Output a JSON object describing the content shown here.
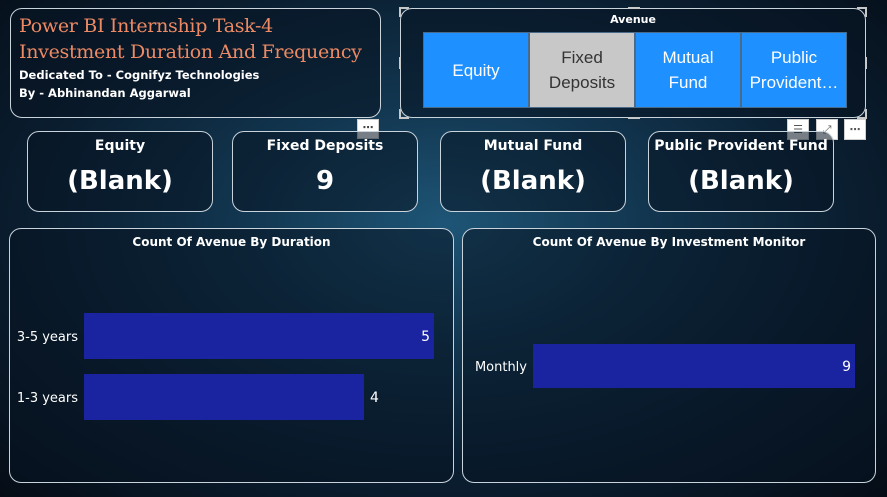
{
  "header": {
    "title_line1": "Power BI Internship Task-4",
    "title_line2": "Investment Duration And Frequency",
    "dedication": "Dedicated To - Cognifyz Technologies",
    "author": "By - Abhinandan Aggarwal",
    "more_icon": "⋯"
  },
  "slicer": {
    "title": "Avenue",
    "options": [
      {
        "label": "Equity",
        "selected": false
      },
      {
        "label": "Fixed Deposits",
        "selected": true
      },
      {
        "label": "Mutual Fund",
        "selected": false
      },
      {
        "label": "Public Provident…",
        "selected": false
      }
    ],
    "toolbar": {
      "filter_icon": "☰",
      "focus_icon": "⤢",
      "more_icon": "⋯"
    }
  },
  "cards": [
    {
      "label": "Equity",
      "value": "(Blank)"
    },
    {
      "label": "Fixed Deposits",
      "value": "9"
    },
    {
      "label": "Mutual Fund",
      "value": "(Blank)"
    },
    {
      "label": "Public Provident Fund",
      "value": "(Blank)"
    }
  ],
  "colors": {
    "bar": "#1a24a0",
    "slicer_active": "#1e90ff",
    "slicer_selected": "#c8c8c8",
    "title": "#ee8a63"
  },
  "chart_data": [
    {
      "type": "bar",
      "orientation": "horizontal",
      "title": "Count Of Avenue By Duration",
      "categories": [
        "3-5 years",
        "1-3 years"
      ],
      "values": [
        5,
        4
      ],
      "xlim": [
        0,
        5
      ]
    },
    {
      "type": "bar",
      "orientation": "horizontal",
      "title": "Count Of Avenue By Investment Monitor",
      "categories": [
        "Monthly"
      ],
      "values": [
        9
      ],
      "xlim": [
        0,
        9
      ]
    }
  ]
}
